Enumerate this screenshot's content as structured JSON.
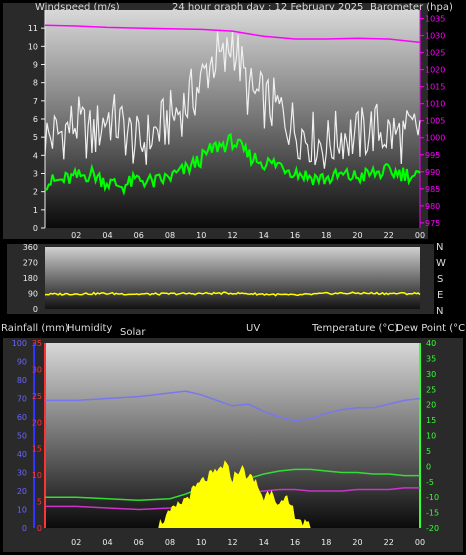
{
  "header": {
    "wind_label": "Windspeed (m/s)",
    "title": "24 hour graph day : 12 February 2025",
    "baro_label": "Barometer (hpa)"
  },
  "compass_labels": [
    "N",
    "W",
    "S",
    "E",
    "N"
  ],
  "bottom_labels": {
    "rain": "Rainfall (mm)",
    "humidity": "Humidity",
    "solar": "Solar",
    "uv": "UV",
    "temp": "Temperature (°C)",
    "dew": "Dew Point (°C)"
  },
  "colors": {
    "gust": "#f0f0f0",
    "wind": "#00ff00",
    "baro": "#ff00ff",
    "direction": "#ffff00",
    "humidity": "#7777ee",
    "temperature": "#33dd33",
    "dewpoint": "#cc33cc",
    "solar": "#ffff00",
    "rain_axis": "#ff3333",
    "humidity_axis": "#3333ff",
    "temp_axis": "#33ff33"
  },
  "chart_data": [
    {
      "type": "line",
      "name": "wind-barometer",
      "x_ticks": [
        "02",
        "04",
        "06",
        "08",
        "10",
        "12",
        "14",
        "16",
        "18",
        "20",
        "22",
        "00"
      ],
      "xlim": [
        0,
        24
      ],
      "ylim_left": [
        0,
        12
      ],
      "yticks_left": [
        0,
        1,
        2,
        3,
        4,
        5,
        6,
        7,
        8,
        9,
        10,
        11
      ],
      "ylim_right": [
        973.5,
        1037.5
      ],
      "yticks_right": [
        975,
        980,
        985,
        990,
        995,
        1000,
        1005,
        1010,
        1015,
        1020,
        1025,
        1030,
        1035
      ],
      "series": [
        {
          "key": "gust",
          "axis": "left",
          "x": [
            0,
            1,
            2,
            3,
            4,
            5,
            6,
            7,
            8,
            9,
            10,
            10.5,
            11,
            11.5,
            12,
            12.5,
            13,
            14,
            15,
            16,
            17,
            18,
            19,
            20,
            21,
            22,
            23,
            24
          ],
          "y": [
            5,
            5.2,
            5.8,
            5,
            6.2,
            5.5,
            4.5,
            5.2,
            6,
            6.8,
            8,
            9,
            9.5,
            9,
            10.5,
            9,
            7.5,
            7,
            6.5,
            5.5,
            5,
            4.5,
            5.2,
            5,
            5.5,
            5.2,
            5,
            5.5
          ]
        },
        {
          "key": "wind",
          "axis": "left",
          "x": [
            0,
            1,
            2,
            3,
            4,
            5,
            6,
            7,
            8,
            9,
            10,
            10.5,
            11,
            11.5,
            12,
            12.5,
            13,
            14,
            15,
            16,
            17,
            18,
            19,
            20,
            21,
            22,
            23,
            24
          ],
          "y": [
            2.5,
            2.6,
            2.8,
            3,
            2.5,
            2.3,
            2.7,
            2.5,
            2.8,
            3.2,
            3.8,
            4.2,
            4.5,
            4.6,
            4.8,
            4.4,
            4,
            3.6,
            3.5,
            3.1,
            2.8,
            2.7,
            2.9,
            2.8,
            3,
            3.1,
            3,
            2.8
          ]
        },
        {
          "key": "baro",
          "axis": "right",
          "x": [
            0,
            2,
            4,
            6,
            8,
            10,
            12,
            13,
            14,
            16,
            18,
            20,
            22,
            24
          ],
          "y": [
            1033,
            1032.8,
            1032.4,
            1032.2,
            1032,
            1031.8,
            1031.3,
            1030.5,
            1029.8,
            1029,
            1029,
            1029.2,
            1029,
            1028
          ]
        }
      ]
    },
    {
      "type": "line",
      "name": "wind-direction",
      "xlim": [
        0,
        24
      ],
      "ylim": [
        0,
        360
      ],
      "yticks": [
        0,
        90,
        180,
        270,
        360
      ],
      "series": [
        {
          "key": "direction",
          "x": [
            0,
            2,
            4,
            6,
            8,
            10,
            12,
            14,
            16,
            18,
            20,
            22,
            24
          ],
          "y": [
            85,
            88,
            90,
            86,
            88,
            90,
            92,
            86,
            80,
            90,
            92,
            90,
            90
          ]
        }
      ]
    },
    {
      "type": "line",
      "name": "rain-humidity-temp",
      "x_ticks": [
        "02",
        "04",
        "06",
        "08",
        "10",
        "12",
        "14",
        "16",
        "18",
        "20",
        "22",
        "00"
      ],
      "xlim": [
        0,
        24
      ],
      "ylim_hum": [
        0,
        100
      ],
      "yticks_hum": [
        0,
        10,
        20,
        30,
        40,
        50,
        60,
        70,
        80,
        90,
        100
      ],
      "ylim_rain": [
        0,
        35
      ],
      "yticks_rain": [
        0,
        5,
        10,
        15,
        20,
        25,
        30,
        35
      ],
      "ylim_temp": [
        -20,
        40
      ],
      "yticks_temp": [
        -20,
        -15,
        -10,
        -5,
        0,
        5,
        10,
        15,
        20,
        25,
        30,
        35,
        40
      ],
      "series": [
        {
          "key": "humidity",
          "axis": "hum",
          "x": [
            0,
            2,
            4,
            6,
            8,
            9,
            10,
            11,
            12,
            13,
            14,
            15,
            16,
            17,
            18,
            19,
            20,
            21,
            22,
            23,
            24
          ],
          "y": [
            69,
            69,
            70,
            71,
            73,
            74,
            72,
            69,
            66,
            67,
            63,
            60,
            58,
            59,
            62,
            64,
            65,
            65,
            67,
            69,
            70
          ]
        },
        {
          "key": "temperature",
          "axis": "temp",
          "x": [
            0,
            2,
            4,
            6,
            8,
            9,
            10,
            11,
            12,
            13,
            14,
            15,
            16,
            17,
            18,
            19,
            20,
            21,
            22,
            23,
            24
          ],
          "y": [
            -10,
            -10,
            -10.5,
            -11,
            -10.5,
            -9,
            -7,
            -6,
            -5,
            -4,
            -2.5,
            -1.5,
            -1,
            -1,
            -1.5,
            -2,
            -2,
            -2.5,
            -2.5,
            -3,
            -3
          ]
        },
        {
          "key": "dewpoint",
          "axis": "temp",
          "x": [
            0,
            2,
            4,
            6,
            8,
            9,
            10,
            11,
            12,
            13,
            14,
            15,
            16,
            17,
            18,
            19,
            20,
            21,
            22,
            23,
            24
          ],
          "y": [
            -13,
            -13,
            -13.5,
            -14,
            -13.5,
            -12.5,
            -11,
            -10,
            -9,
            -8.5,
            -8,
            -7.5,
            -7.5,
            -8,
            -8,
            -8,
            -7.5,
            -7.5,
            -7.5,
            -7,
            -7
          ]
        },
        {
          "key": "solar",
          "axis": "hum",
          "fill": true,
          "x": [
            7,
            8,
            9,
            10,
            10.5,
            11,
            11.5,
            12,
            12.5,
            13,
            13.5,
            14,
            14.5,
            15,
            15.5,
            16,
            16.5,
            17
          ],
          "y": [
            0,
            8,
            16,
            25,
            28,
            30,
            35,
            27,
            33,
            28,
            25,
            16,
            22,
            12,
            15,
            8,
            3,
            0
          ]
        }
      ]
    }
  ]
}
